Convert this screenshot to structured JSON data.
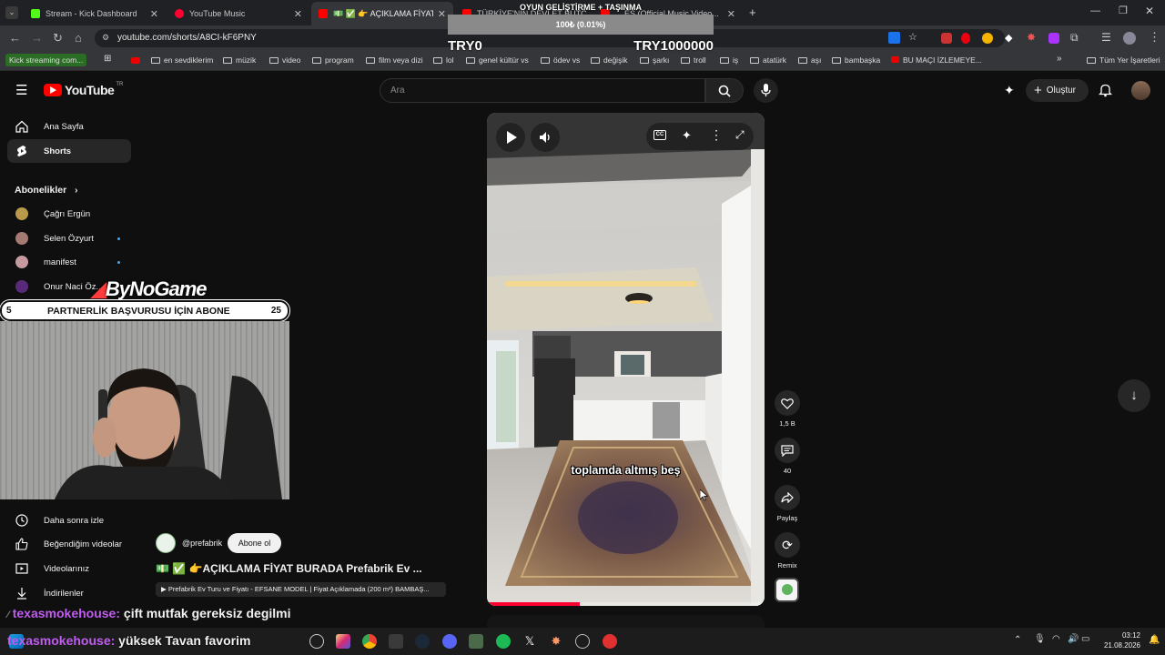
{
  "browser": {
    "tabs": [
      {
        "title": "Stream - Kick Dashboard"
      },
      {
        "title": "YouTube Music"
      },
      {
        "title": "💵 ✅ 👉 AÇIKLAMA FİYAT B"
      },
      {
        "title": "TÜRKİYE'NİN DEVLET BÜTÇESİ..."
      },
      {
        "title": "... ES (Official Music Video..."
      }
    ],
    "url": "youtube.com/shorts/A8CI-kF6PNY",
    "bookmarks": [
      "Kick streaming com...",
      "en sevdiklerim",
      "müzik",
      "video",
      "program",
      "film veya dizi",
      "lol",
      "genel kültür vs",
      "ödev vs",
      "değişik",
      "şarkı",
      "troll",
      "iş",
      "atatürk",
      "aşı",
      "bambaşka",
      "BU MAÇI İZLEMEYE...",
      "Tüm Yer İşaretleri"
    ]
  },
  "stream_overlay": {
    "goal_title": "OYUN GELİŞTİRME + TAŞINMA",
    "goal_progress_text": "100₺ (0.01%)",
    "goal_progress": 0.0001,
    "goal_start": "TRY0",
    "goal_end": "TRY1000000",
    "brand": "ByNoGame",
    "banner_left": "5",
    "banner_text": "PARTNERLİK BAŞVURUSU İÇİN ABONE",
    "banner_right": "25",
    "chat": [
      {
        "user": "texasmokehouse:",
        "message": "çift mutfak gereksiz degilmi"
      },
      {
        "user": "texasmokehouse:",
        "message": "yüksek Tavan favorim"
      }
    ]
  },
  "youtube": {
    "logo": "YouTube",
    "logo_region": "TR",
    "search_placeholder": "Ara",
    "create_label": "Oluştur",
    "sidebar": {
      "home": "Ana Sayfa",
      "shorts": "Shorts",
      "subscriptions_header": "Abonelikler",
      "subscriptions": [
        {
          "name": "Çağrı Ergün",
          "new": false
        },
        {
          "name": "Selen Özyurt",
          "new": true
        },
        {
          "name": "manifest",
          "new": true
        },
        {
          "name": "Onur Naci Öz...",
          "new": false
        }
      ],
      "watch_later": "Daha sonra izle",
      "liked": "Beğendiğim videolar",
      "your_videos": "Videolarınız",
      "downloads": "İndirilenler"
    },
    "short": {
      "caption": "toplamda altmış beş",
      "channel": "@prefabrik",
      "subscribe": "Abone ol",
      "title": "💵 ✅ 👉AÇIKLAMA FİYAT BURADA Prefabrik Ev ...",
      "related": "Prefabrik Ev Turu ve Fiyatı - EFSANE MODEL | Fiyat Açıklamada (200 m²) BAMBAŞ...",
      "likes": "1,5 B",
      "comments": "40",
      "share": "Paylaş",
      "remix": "Remix"
    }
  },
  "taskbar": {
    "time": "03:12",
    "date": "21.08.2026"
  },
  "colors": {
    "yt_red": "#ff0000",
    "chat_user": "#c05cf0",
    "kick_green": "#53fc18"
  }
}
